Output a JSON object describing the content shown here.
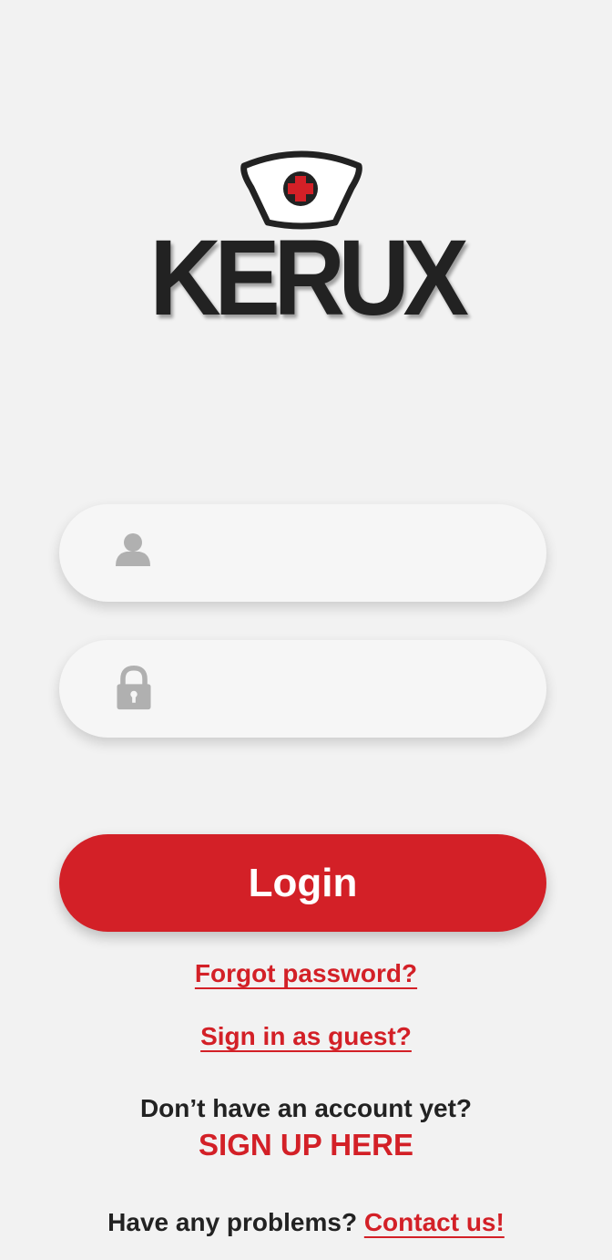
{
  "app": {
    "logo_text": "KERUX",
    "logo_icon": "nurse-cap-red-cross-icon"
  },
  "form": {
    "username": {
      "icon": "user-icon",
      "value": "",
      "placeholder": ""
    },
    "password": {
      "icon": "lock-icon",
      "value": "",
      "placeholder": ""
    },
    "login_label": "Login"
  },
  "links": {
    "forgot_password": "Forgot password?",
    "guest": "Sign in as guest?",
    "no_account": "Don’t have an account yet?",
    "sign_up": "SIGN UP HERE",
    "problems": "Have any problems?",
    "contact": "Contact us!"
  },
  "colors": {
    "accent": "#d32027",
    "background": "#f2f2f2",
    "field_bg": "#f6f6f6",
    "icon_gray": "#b0b0b0",
    "text_dark": "#222222"
  }
}
